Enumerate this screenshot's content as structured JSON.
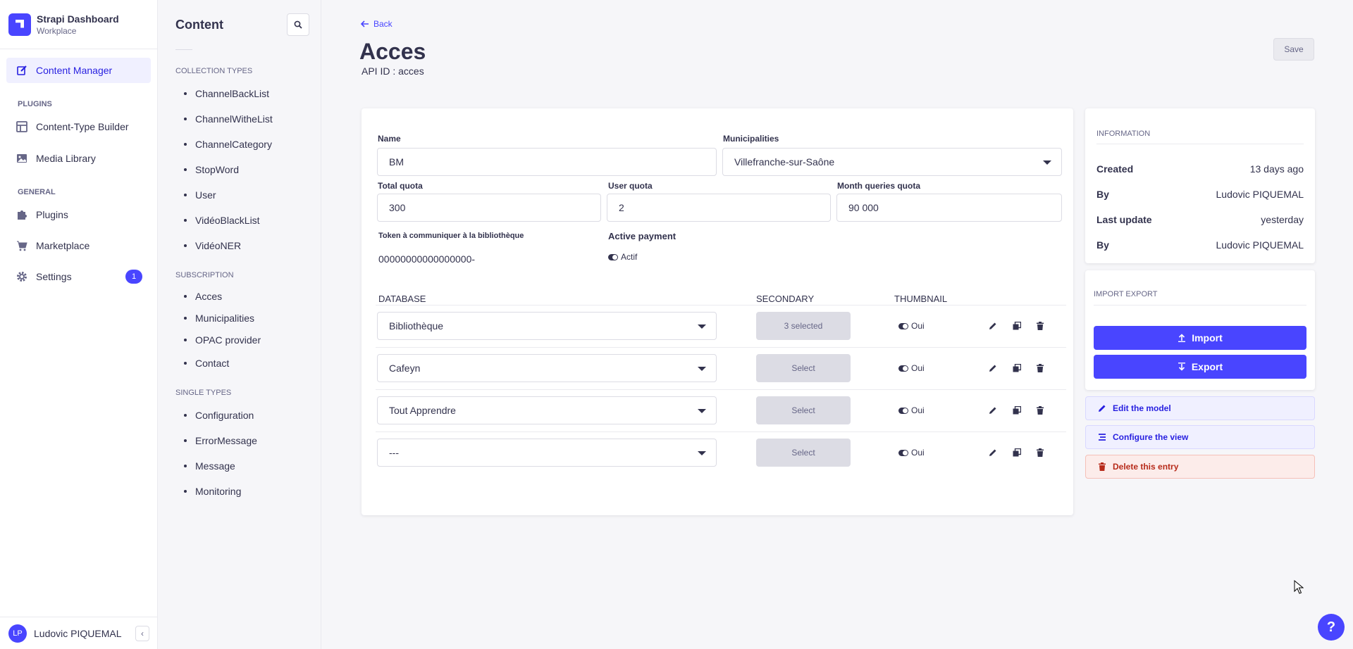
{
  "brand": {
    "title": "Strapi Dashboard",
    "subtitle": "Workplace"
  },
  "leftnav": {
    "active": "Content Manager",
    "plugins_section": "PLUGINS",
    "general_section": "GENERAL",
    "items": [
      {
        "label": "Content Manager",
        "icon": "pencil-icon"
      },
      {
        "label": "Content-Type Builder",
        "icon": "layout-icon"
      },
      {
        "label": "Media Library",
        "icon": "image-icon"
      },
      {
        "label": "Plugins",
        "icon": "puzzle-icon"
      },
      {
        "label": "Marketplace",
        "icon": "cart-icon"
      },
      {
        "label": "Settings",
        "icon": "gear-icon",
        "badge": "1"
      }
    ],
    "user": {
      "initials": "LP",
      "name": "Ludovic PIQUEMAL"
    }
  },
  "subnav": {
    "title": "Content",
    "collection_section": "COLLECTION TYPES",
    "collection_items": [
      "ChannelBackList",
      "ChannelWitheList",
      "ChannelCategory",
      "StopWord",
      "User",
      "VidéoBlackList",
      "VidéoNER"
    ],
    "subscription_section": "SUBSCRIPTION",
    "subscription_items": [
      "Acces",
      "Municipalities",
      "OPAC provider",
      "Contact"
    ],
    "single_section": "SINGLE TYPES",
    "single_items": [
      "Configuration",
      "ErrorMessage",
      "Message",
      "Monitoring"
    ]
  },
  "header": {
    "back": "Back",
    "title": "Acces",
    "api_id": "API ID : acces",
    "save": "Save"
  },
  "form": {
    "name_label": "Name",
    "name_value": "BM",
    "municipalities_label": "Municipalities",
    "municipalities_value": "Villefranche-sur-Saône",
    "total_quota_label": "Total quota",
    "total_quota_value": "300",
    "user_quota_label": "User quota",
    "user_quota_value": "2",
    "month_quota_label": "Month queries quota",
    "month_quota_value": "90 000",
    "token_label": "Token à communiquer à la bibliothèque",
    "token_value": "00000000000000000-",
    "payment_label": "Active payment",
    "payment_value": "Actif"
  },
  "database_table": {
    "headers": {
      "database": "DATABASE",
      "secondary": "SECONDARY",
      "thumbnail": "THUMBNAIL"
    },
    "rows": [
      {
        "database": "Bibliothèque",
        "secondary": "3 selected",
        "thumbnail": "Oui"
      },
      {
        "database": "Cafeyn",
        "secondary": "Select",
        "thumbnail": "Oui"
      },
      {
        "database": "Tout Apprendre",
        "secondary": "Select",
        "thumbnail": "Oui"
      },
      {
        "database": "---",
        "secondary": "Select",
        "thumbnail": "Oui"
      }
    ]
  },
  "information": {
    "section": "INFORMATION",
    "rows": [
      {
        "key": "Created",
        "value": "13 days ago"
      },
      {
        "key": "By",
        "value": "Ludovic PIQUEMAL"
      },
      {
        "key": "Last update",
        "value": "yesterday"
      },
      {
        "key": "By",
        "value": "Ludovic PIQUEMAL"
      }
    ]
  },
  "import_export": {
    "section": "IMPORT EXPORT",
    "import": "Import",
    "export": "Export"
  },
  "side_links": {
    "edit_model": "Edit the model",
    "configure_view": "Configure the view",
    "delete_entry": "Delete this entry"
  },
  "help": "?",
  "colors": {
    "primary": "#4945ff",
    "danger": "#b72b1a"
  }
}
